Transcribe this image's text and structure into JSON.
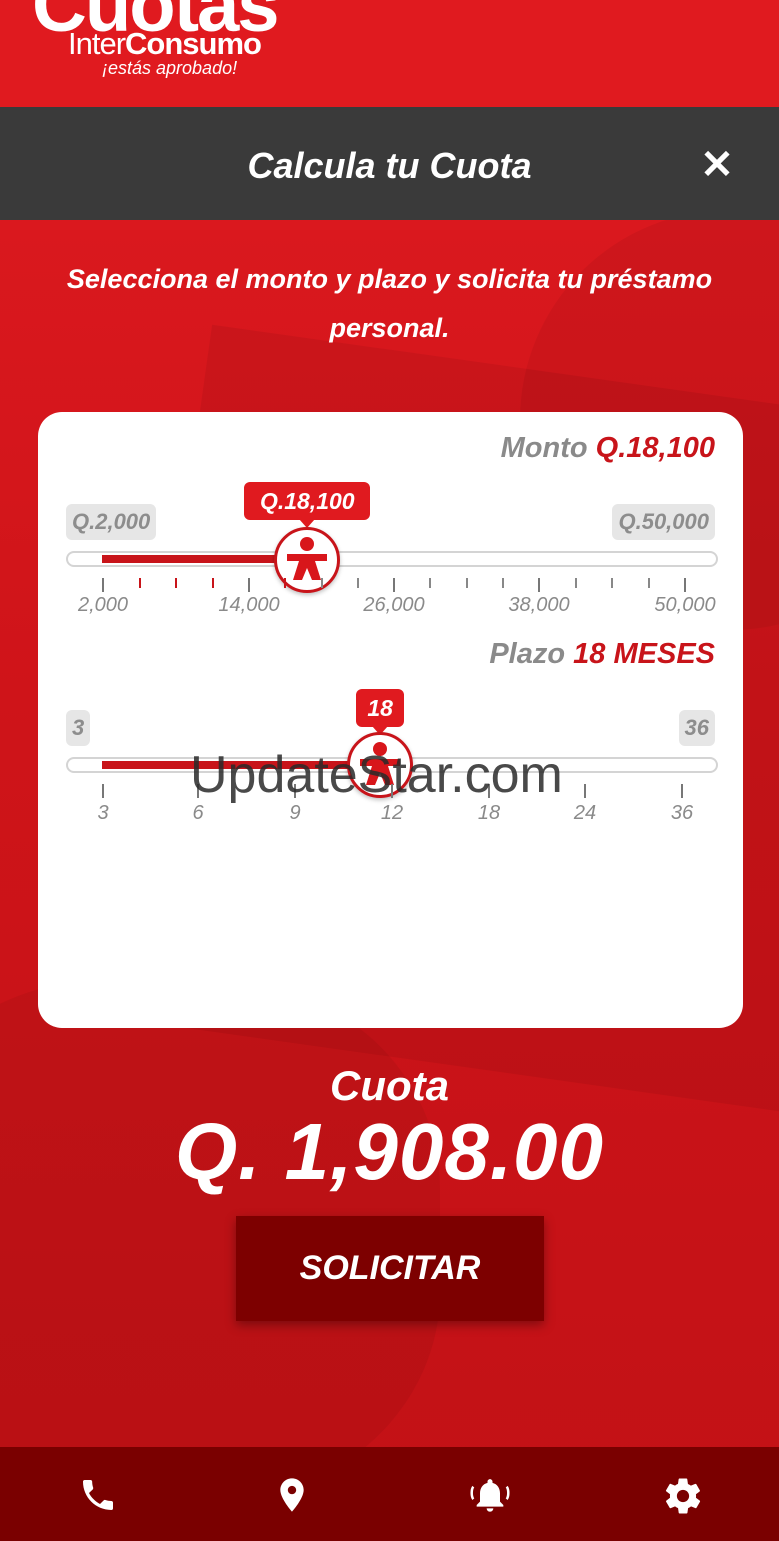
{
  "logo": {
    "main": "Cuotas",
    "sub_prefix": "Inter",
    "sub_bold": "Consumo",
    "tagline": "¡estás aprobado!"
  },
  "header": {
    "title": "Calcula tu Cuota",
    "close_icon": "close-icon"
  },
  "intro_text": "Selecciona el monto y plazo y solicita tu préstamo personal.",
  "monto": {
    "label": "Monto",
    "value_display": "Q.18,100",
    "min_chip": "Q.2,000",
    "max_chip": "Q.50,000",
    "bubble": "Q.18,100",
    "value": 18100,
    "min": 2000,
    "max": 50000,
    "tick_labels": [
      "2,000",
      "14,000",
      "26,000",
      "38,000",
      "50,000"
    ]
  },
  "plazo": {
    "label": "Plazo",
    "value_display": "18 MESES",
    "min_chip": "3",
    "max_chip": "36",
    "bubble": "18",
    "value": 18,
    "min": 3,
    "max": 36,
    "tick_labels": [
      "3",
      "6",
      "9",
      "12",
      "18",
      "24",
      "36"
    ]
  },
  "result": {
    "label": "Cuota",
    "value": "Q. 1,908.00"
  },
  "solicitar_label": "SOLICITAR",
  "bottom_nav": [
    "phone-icon",
    "location-pin-icon",
    "notification-bell-icon",
    "settings-gear-icon"
  ],
  "watermark": "UpdateStar.com",
  "colors": {
    "brand_red": "#e01a1f",
    "header_gray": "#3a3a3a",
    "dark_red": "#7d0000"
  }
}
